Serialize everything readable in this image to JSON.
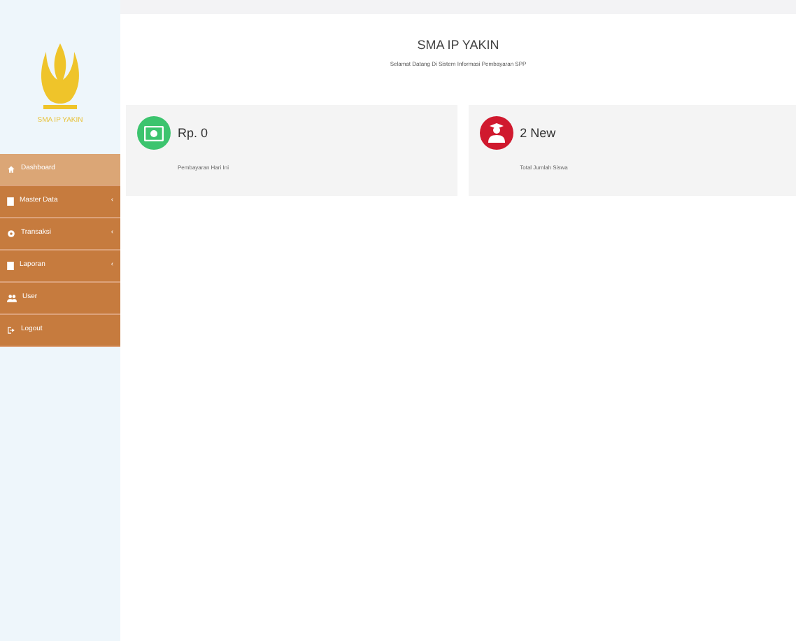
{
  "sidebar": {
    "logo_text": "SMA IP YAKIN",
    "items": [
      {
        "label": "Dashboard",
        "kind": "home",
        "selected": true
      },
      {
        "label": "Master Data",
        "kind": "doc",
        "selected": false,
        "caret": "‹"
      },
      {
        "label": "Transaksi",
        "kind": "gear",
        "selected": false,
        "caret": "‹"
      },
      {
        "label": "Laporan",
        "kind": "doc",
        "selected": false,
        "caret": "‹"
      },
      {
        "label": "User",
        "kind": "users",
        "selected": false
      },
      {
        "label": "Logout",
        "kind": "exit",
        "selected": false
      }
    ]
  },
  "header": {
    "title": "SMA IP YAKIN",
    "subtitle": "Selamat Datang Di Sistem Informasi Pembayaran SPP"
  },
  "stats": [
    {
      "value": "Rp. 0",
      "label": "Pembayaran Hari Ini",
      "kind": "money",
      "color": "#3cc46e"
    },
    {
      "value": "2 New",
      "label": "Total Jumlah Siswa",
      "kind": "student",
      "color": "#d0192e"
    }
  ]
}
